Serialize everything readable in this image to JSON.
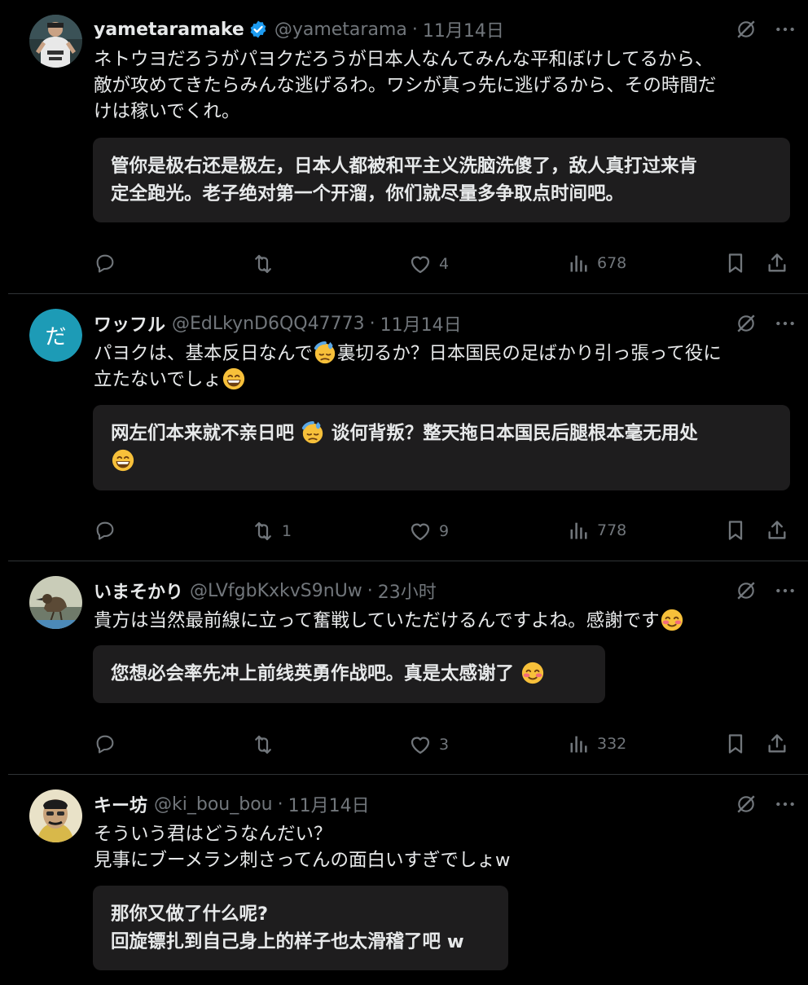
{
  "tweets": [
    {
      "name": "yametaramake",
      "handle": "@yametarama",
      "time": "11月14日",
      "verified": true,
      "lines": [
        "ネトウヨだろうがパヨクだろうが日本人なんてみんな平和ぼけしてるから、",
        "敵が攻めてきたらみんな逃げるわ。ワシが真っ先に逃げるから、その時間だ",
        "けは稼いでくれ。"
      ],
      "translation": [
        "管你是极右还是极左，日本人都被和平主义洗脑洗傻了，敌人真打过来肯",
        "定全跑光。老子绝对第一个开溜，你们就尽量多争取点时间吧。"
      ],
      "replies": "",
      "retweets": "",
      "likes": "4",
      "views": "678"
    },
    {
      "name": "ワッフル",
      "handle": "@EdLkynD6QQ47773",
      "time": "11月14日",
      "avatar_letter": "だ",
      "line1_a": "パヨクは、基本反日なんで",
      "line1_b": "裏切るか？日本国民の足ばかり引っ張って役に",
      "line2": "立たないでしょ",
      "translation_a": "网左们本来就不亲日吧",
      "translation_b": "谈何背叛？整天拖日本国民后腿根本毫无用处",
      "replies": "",
      "retweets": "1",
      "likes": "9",
      "views": "778"
    },
    {
      "name": "いまそかり",
      "handle": "@LVfgbKxkvS9nUw",
      "time": "23小时",
      "line1": "貴方は当然最前線に立って奮戦していただけるんですよね。感謝です",
      "translation": "您想必会率先冲上前线英勇作战吧。真是太感谢了",
      "replies": "",
      "retweets": "",
      "likes": "3",
      "views": "332"
    },
    {
      "name": "キー坊",
      "handle": "@ki_bou_bou",
      "time": "11月14日",
      "lines": [
        "そういう君はどうなんだい？",
        "見事にブーメラン刺さってんの面白いすぎでしょw"
      ],
      "translation": [
        "那你又做了什么呢?",
        "回旋镖扎到自己身上的样子也太滑稽了吧 w"
      ]
    }
  ],
  "sep": "·",
  "icons": [
    "grok-icon",
    "more-icon",
    "reply-icon",
    "retweet-icon",
    "like-icon",
    "views-icon",
    "bookmark-icon",
    "share-icon",
    "verified-badge-icon",
    "sweat-emoji",
    "grin-emoji",
    "blush-emoji"
  ],
  "colors": {
    "background": "#000000",
    "text": "#e7e9ea",
    "muted": "#71767b",
    "verified": "#1d9bf0",
    "translation_bg": "#1e1d1e",
    "divider": "#2f3336"
  }
}
